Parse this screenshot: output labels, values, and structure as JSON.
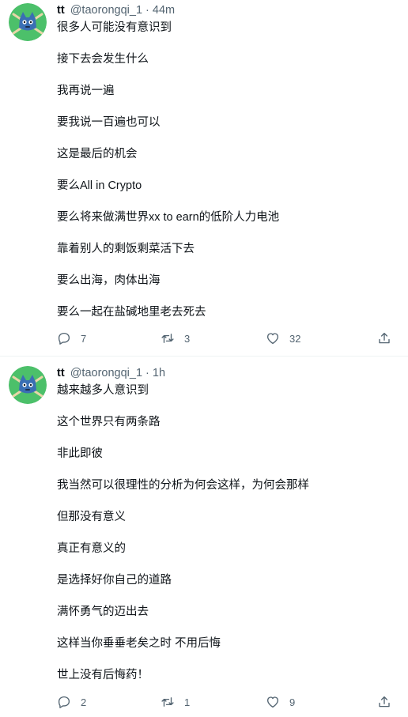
{
  "tweets": [
    {
      "author": {
        "name": "tt",
        "handle": "@taorongqi_1"
      },
      "separator": "·",
      "time": "44m",
      "lines": [
        "很多人可能没有意识到",
        "接下去会发生什么",
        "我再说一遍",
        "要我说一百遍也可以",
        "这是最后的机会",
        "要么All in Crypto",
        "要么将来做满世界xx to earn的低阶人力电池",
        "靠着别人的剩饭剩菜活下去",
        "要么出海，肉体出海",
        "要么一起在盐碱地里老去死去"
      ],
      "stats": {
        "replies": "7",
        "retweets": "3",
        "likes": "32"
      }
    },
    {
      "author": {
        "name": "tt",
        "handle": "@taorongqi_1"
      },
      "separator": "·",
      "time": "1h",
      "lines": [
        "越来越多人意识到",
        "这个世界只有两条路",
        "非此即彼",
        "我当然可以很理性的分析为何会这样，为何会那样",
        "但那没有意义",
        "真正有意义的",
        "是选择好你自己的道路",
        "满怀勇气的迈出去",
        "这样当你垂垂老矣之时 不用后悔",
        "世上没有后悔药！"
      ],
      "stats": {
        "replies": "2",
        "retweets": "1",
        "likes": "9"
      }
    }
  ],
  "icons": {
    "reply": "reply-icon",
    "retweet": "retweet-icon",
    "like": "heart-icon",
    "share": "share-icon"
  },
  "colors": {
    "text": "#0f1419",
    "secondary": "#536471",
    "divider": "#eff3f4",
    "avatar_bg": "#4cc06a"
  }
}
